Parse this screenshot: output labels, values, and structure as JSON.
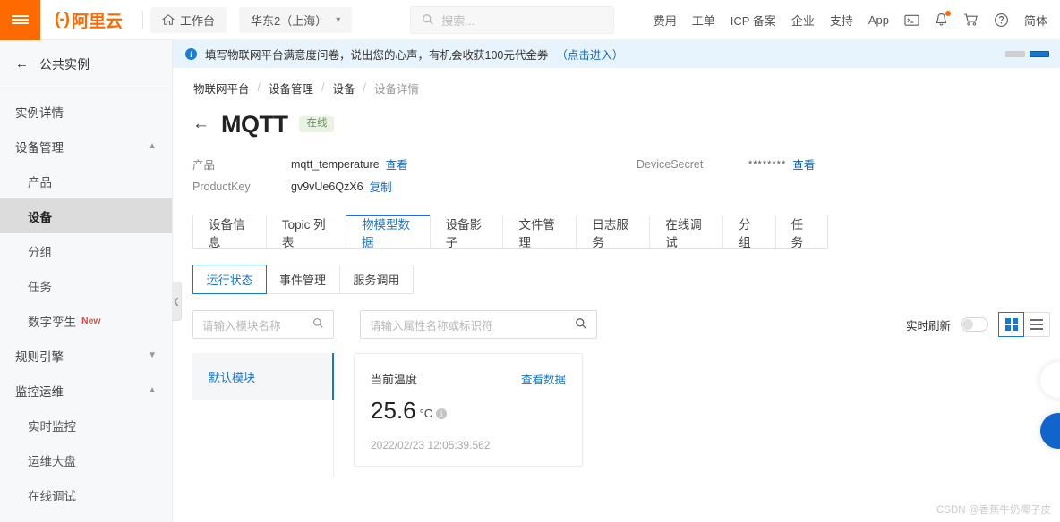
{
  "header": {
    "hamburger_icon": "hamburger-icon",
    "logo_mark": "(-)",
    "logo_text": "阿里云",
    "workbench": {
      "label": "工作台",
      "icon": "home-icon"
    },
    "region": {
      "label": "华东2（上海）",
      "icon": "chevron-down-icon"
    },
    "search": {
      "placeholder": "搜索...",
      "icon": "search-icon"
    },
    "nav_items": [
      {
        "label": "费用"
      },
      {
        "label": "工单"
      },
      {
        "label": "ICP 备案"
      },
      {
        "label": "企业"
      },
      {
        "label": "支持"
      },
      {
        "label": "App"
      }
    ],
    "icons": [
      {
        "name": "terminal-icon"
      },
      {
        "name": "bell-icon",
        "has_badge": true
      },
      {
        "name": "cart-icon"
      },
      {
        "name": "help-icon"
      }
    ],
    "language": "简体"
  },
  "sidebar": {
    "back_label": "公共实例",
    "back_icon": "arrow-left-icon",
    "items": [
      {
        "label": "实例详情",
        "level": "top",
        "active": false,
        "expandable": false
      },
      {
        "label": "设备管理",
        "level": "top",
        "active": false,
        "expandable": true,
        "expanded": true,
        "chevron": "chevron-up-icon"
      },
      {
        "label": "产品",
        "level": "sub",
        "active": false
      },
      {
        "label": "设备",
        "level": "sub",
        "active": true
      },
      {
        "label": "分组",
        "level": "sub",
        "active": false
      },
      {
        "label": "任务",
        "level": "sub",
        "active": false
      },
      {
        "label": "数字孪生",
        "level": "sub",
        "active": false,
        "tag": "New"
      },
      {
        "label": "规则引擎",
        "level": "top",
        "active": false,
        "expandable": true,
        "expanded": false,
        "chevron": "chevron-down-icon"
      },
      {
        "label": "监控运维",
        "level": "top",
        "active": false,
        "expandable": true,
        "expanded": true,
        "chevron": "chevron-up-icon"
      },
      {
        "label": "实时监控",
        "level": "sub",
        "active": false
      },
      {
        "label": "运维大盘",
        "level": "sub",
        "active": false
      },
      {
        "label": "在线调试",
        "level": "sub",
        "active": false
      }
    ],
    "collapse_icon": "chevron-left-icon"
  },
  "banner": {
    "icon": "info-icon",
    "text": "填写物联网平台满意度问卷，说出您的心声，有机会收获100元代金券",
    "link": "（点击进入）"
  },
  "breadcrumb": [
    {
      "label": "物联网平台",
      "last": false
    },
    {
      "label": "设备管理",
      "last": false
    },
    {
      "label": "设备",
      "last": false
    },
    {
      "label": "设备详情",
      "last": true
    }
  ],
  "breadcrumb_sep": "/",
  "page": {
    "back_icon": "arrow-left-icon",
    "title": "MQTT",
    "status": "在线",
    "status_color": "#6a9456"
  },
  "meta": {
    "product_label": "产品",
    "product_value": "mqtt_temperature",
    "product_link": "查看",
    "productkey_label": "ProductKey",
    "productkey_value": "gv9vUe6QzX6",
    "productkey_link": "复制",
    "secret_label": "DeviceSecret",
    "secret_value": "********",
    "secret_link": "查看"
  },
  "tabs": [
    {
      "label": "设备信息",
      "active": false
    },
    {
      "label": "Topic 列表",
      "active": false
    },
    {
      "label": "物模型数据",
      "active": true
    },
    {
      "label": "设备影子",
      "active": false
    },
    {
      "label": "文件管理",
      "active": false
    },
    {
      "label": "日志服务",
      "active": false
    },
    {
      "label": "在线调试",
      "active": false
    },
    {
      "label": "分组",
      "active": false
    },
    {
      "label": "任务",
      "active": false
    }
  ],
  "subtabs": [
    {
      "label": "运行状态",
      "active": true
    },
    {
      "label": "事件管理",
      "active": false
    },
    {
      "label": "服务调用",
      "active": false
    }
  ],
  "filters": {
    "module_placeholder": "请输入模块名称",
    "property_placeholder": "请输入属性名称或标识符",
    "search_icon": "search-icon",
    "refresh_label": "实时刷新",
    "refresh_on": false,
    "view_grid_icon": "grid-view-icon",
    "view_list_icon": "list-view-icon",
    "view_mode": "grid",
    "accent_color": "#1677d2"
  },
  "modules": [
    {
      "label": "默认模块",
      "active": true
    }
  ],
  "property_cards": [
    {
      "title": "当前温度",
      "link": "查看数据",
      "value": "25.6",
      "unit": "°C",
      "info_icon": "info-icon",
      "timestamp": "2022/02/23 12:05:39.562"
    }
  ],
  "float_buttons": [
    {
      "name": "float-button-top",
      "icon": ""
    },
    {
      "name": "float-button-bottom",
      "icon": ""
    }
  ],
  "watermark": "CSDN @香蕉牛奶椰子皮"
}
